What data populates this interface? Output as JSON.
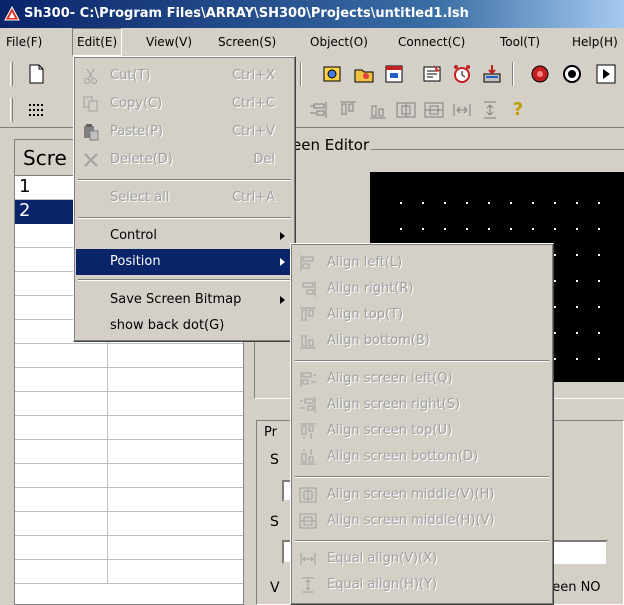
{
  "window": {
    "title": "Sh300- C:\\Program Files\\ARRAY\\SH300\\Projects\\untitled1.lsh"
  },
  "menubar": [
    "File(F)",
    "Edit(E)",
    "View(V)",
    "Screen(S)",
    "Object(O)",
    "Connect(C)",
    "Tool(T)",
    "Help(H)"
  ],
  "edit_menu": {
    "cut": {
      "label": "Cut(T)",
      "shortcut": "Ctrl+X"
    },
    "copy": {
      "label": "Copy(C)",
      "shortcut": "Ctrl+C"
    },
    "paste": {
      "label": "Paste(P)",
      "shortcut": "Ctrl+V"
    },
    "delete": {
      "label": "Delete(D)",
      "shortcut": "Del"
    },
    "select_all": {
      "label": "Select all",
      "shortcut": "Ctrl+A"
    },
    "control": "Control",
    "position": "Position",
    "save_bitmap": "Save Screen Bitmap",
    "show_back_dot": "show back dot(G)"
  },
  "position_menu": [
    "Align left(L)",
    "Align right(R)",
    "Align top(T)",
    "Align bottom(B)",
    "Align screen left(Q)",
    "Align screen right(S)",
    "Align screen top(U)",
    "Align screen bottom(D)",
    "Align screen middle(V)(H)",
    "Align screen middle(H)(V)",
    "Equal align(V)(X)",
    "Equal align(H)(Y)"
  ],
  "left_panel": {
    "header": "Scre",
    "rows": [
      "1",
      "2"
    ]
  },
  "editor": {
    "legend": "een Editor"
  },
  "properties": {
    "legend": "Pr",
    "labels": [
      "S",
      "S",
      "V"
    ],
    "screen_no": "creen NO"
  },
  "toolbar2": {
    "help_glyph": "?"
  },
  "colors": {
    "selection": "#0a246a",
    "face": "#d4d0c8",
    "canvas": "#000000"
  }
}
